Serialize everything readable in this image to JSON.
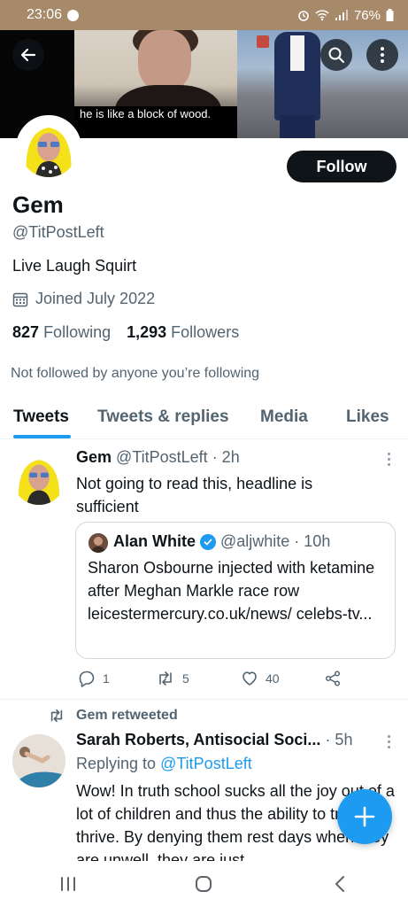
{
  "status_bar": {
    "time": "23:06",
    "battery": "76%"
  },
  "banner": {
    "caption": "he is like a block of wood."
  },
  "profile": {
    "name": "Gem",
    "handle": "@TitPostLeft",
    "bio": "Live Laugh Squirt",
    "joined": "Joined July 2022",
    "following_count": "827",
    "following_label": "Following",
    "followers_count": "1,293",
    "followers_label": "Followers",
    "not_followed": "Not followed by anyone you’re following",
    "follow_label": "Follow"
  },
  "tabs": [
    {
      "label": "Tweets",
      "active": true
    },
    {
      "label": "Tweets & replies",
      "active": false
    },
    {
      "label": "Media",
      "active": false
    },
    {
      "label": "Likes",
      "active": false
    }
  ],
  "tweets": [
    {
      "author": "Gem",
      "handle_time": "@TitPostLeft · 2h",
      "text": "Not going to read this, headline is sufficient",
      "quote": {
        "author": "Alan White",
        "handle_time": "@aljwhite · 10h",
        "text": "Sharon Osbourne injected with ketamine after Meghan Markle race row leicestermercury.co.uk/news/ celebs-tv..."
      },
      "replies": "1",
      "retweets": "5",
      "likes": "40"
    },
    {
      "retweet_label": "Gem retweeted",
      "author": "Sarah Roberts, Antisocial Soci...",
      "time": "· 5h",
      "replying_prefix": "Replying to",
      "replying_to": "@TitPostLeft",
      "text": "Wow! In truth school sucks all the joy out of a lot of children and thus the ability to truly thrive. By denying them rest days when they are unwell, they are just"
    }
  ],
  "colors": {
    "accent": "#1d9bf0",
    "text_primary": "#0f1419",
    "text_secondary": "#536471",
    "status_bar": "#a68a6a"
  }
}
